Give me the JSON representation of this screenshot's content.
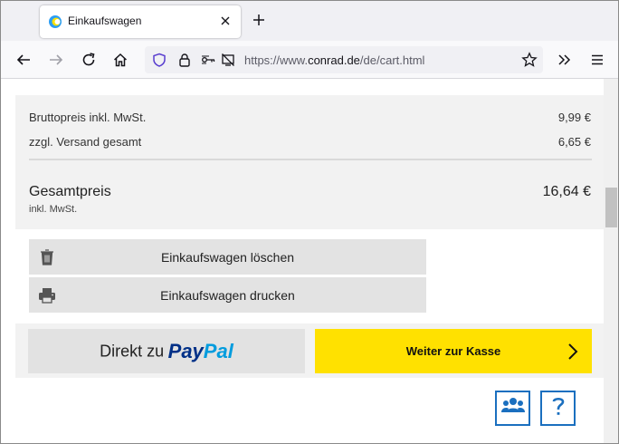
{
  "browser": {
    "tab_title": "Einkaufswagen",
    "url_prefix": "https://www.",
    "url_domain": "conrad.de",
    "url_path": "/de/cart.html"
  },
  "summary": {
    "gross_label": "Bruttopreis inkl. MwSt.",
    "gross_value": "9,99 €",
    "shipping_label": "zzgl. Versand gesamt",
    "shipping_value": "6,65 €",
    "total_label": "Gesamtpreis",
    "total_sub": "inkl. MwSt.",
    "total_value": "16,64 €"
  },
  "actions": {
    "delete_label": "Einkaufswagen löschen",
    "print_label": "Einkaufswagen drucken"
  },
  "checkout": {
    "paypal_prefix": "Direkt zu",
    "paypal_brand_1": "Pay",
    "paypal_brand_2": "Pal",
    "continue_label": "Weiter zur Kasse"
  },
  "colors": {
    "accent_yellow": "#ffe100",
    "help_blue": "#1a6fbf",
    "paypal_dark": "#003087",
    "paypal_light": "#009cde"
  }
}
